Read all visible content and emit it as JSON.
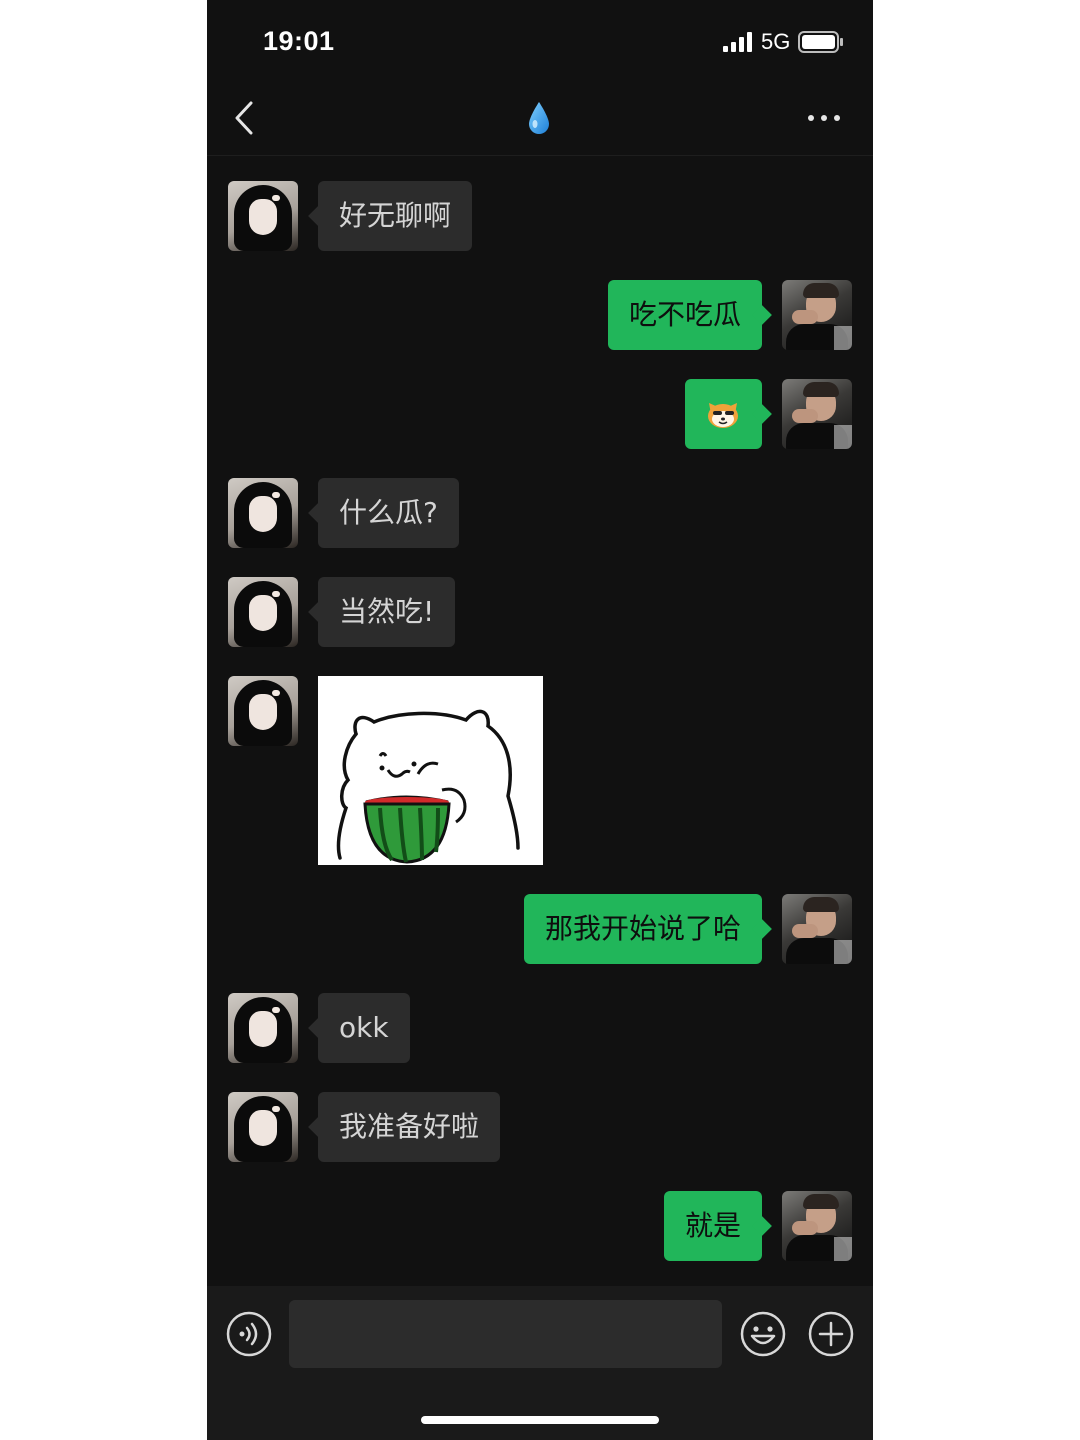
{
  "status_bar": {
    "time": "19:01",
    "network": "5G",
    "icons": [
      "signal-icon",
      "battery-icon"
    ]
  },
  "nav": {
    "title_icon": "droplet-icon",
    "back_icon": "chevron-left-icon",
    "more_icon": "more-icon"
  },
  "messages": [
    {
      "side": "left",
      "type": "text",
      "text": "好无聊啊"
    },
    {
      "side": "right",
      "type": "text",
      "text": "吃不吃瓜"
    },
    {
      "side": "right",
      "type": "emoji",
      "text": "🐱"
    },
    {
      "side": "left",
      "type": "text",
      "text": "什么瓜?"
    },
    {
      "side": "left",
      "type": "text",
      "text": "当然吃!"
    },
    {
      "side": "left",
      "type": "sticker",
      "description_icon": "cat-eating-watermelon-sticker"
    },
    {
      "side": "right",
      "type": "text",
      "text": "那我开始说了哈"
    },
    {
      "side": "left",
      "type": "text",
      "text": "okk"
    },
    {
      "side": "left",
      "type": "text",
      "text": "我准备好啦"
    },
    {
      "side": "right",
      "type": "text",
      "text": "就是"
    }
  ],
  "input_bar": {
    "value": "",
    "placeholder": "",
    "icons": [
      "voice-icon",
      "emoji-icon",
      "plus-icon"
    ]
  },
  "colors": {
    "background": "#111111",
    "outgoing_bubble": "#21b65a",
    "incoming_bubble": "#2c2c2c"
  }
}
